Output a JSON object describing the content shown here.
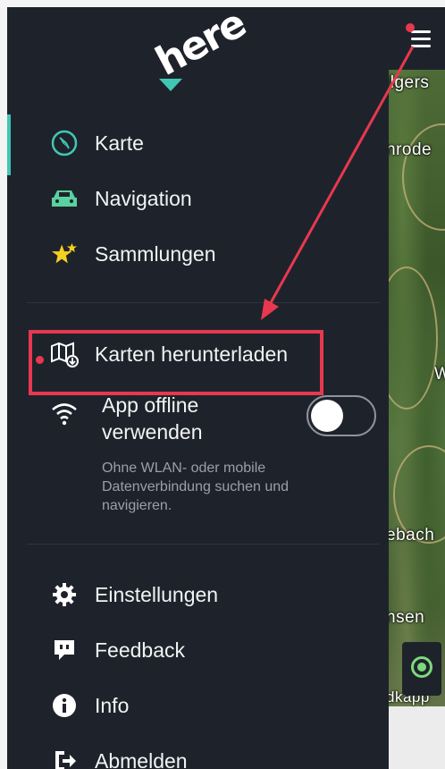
{
  "map": {
    "labels": [
      "ilgers",
      "nrode",
      "W",
      "ebach",
      "nsen",
      "dkapp"
    ]
  },
  "sidebar": {
    "logo_text": "here",
    "nav_items": [
      {
        "label": "Karte",
        "icon": "compass-icon"
      },
      {
        "label": "Navigation",
        "icon": "car-icon"
      },
      {
        "label": "Sammlungen",
        "icon": "stars-icon"
      }
    ],
    "download_item": {
      "label": "Karten herunterladen",
      "icon": "map-download-icon"
    },
    "offline": {
      "label": "App offline verwenden",
      "description": "Ohne WLAN- oder mobile Datenverbindung suchen und navigieren.",
      "toggle_on": false,
      "icon": "wifi-icon"
    },
    "bottom_items": [
      {
        "label": "Einstellungen",
        "icon": "gear-icon"
      },
      {
        "label": "Feedback",
        "icon": "chat-bubble-icon"
      },
      {
        "label": "Info",
        "icon": "info-icon"
      },
      {
        "label": "Abmelden",
        "icon": "logout-icon"
      }
    ]
  },
  "colors": {
    "sidebar_bg": "#1e232b",
    "accent": "#42c6b4",
    "highlight": "#e8384f",
    "car_icon": "#5ad1a0",
    "stars_icon": "#f5d020"
  }
}
